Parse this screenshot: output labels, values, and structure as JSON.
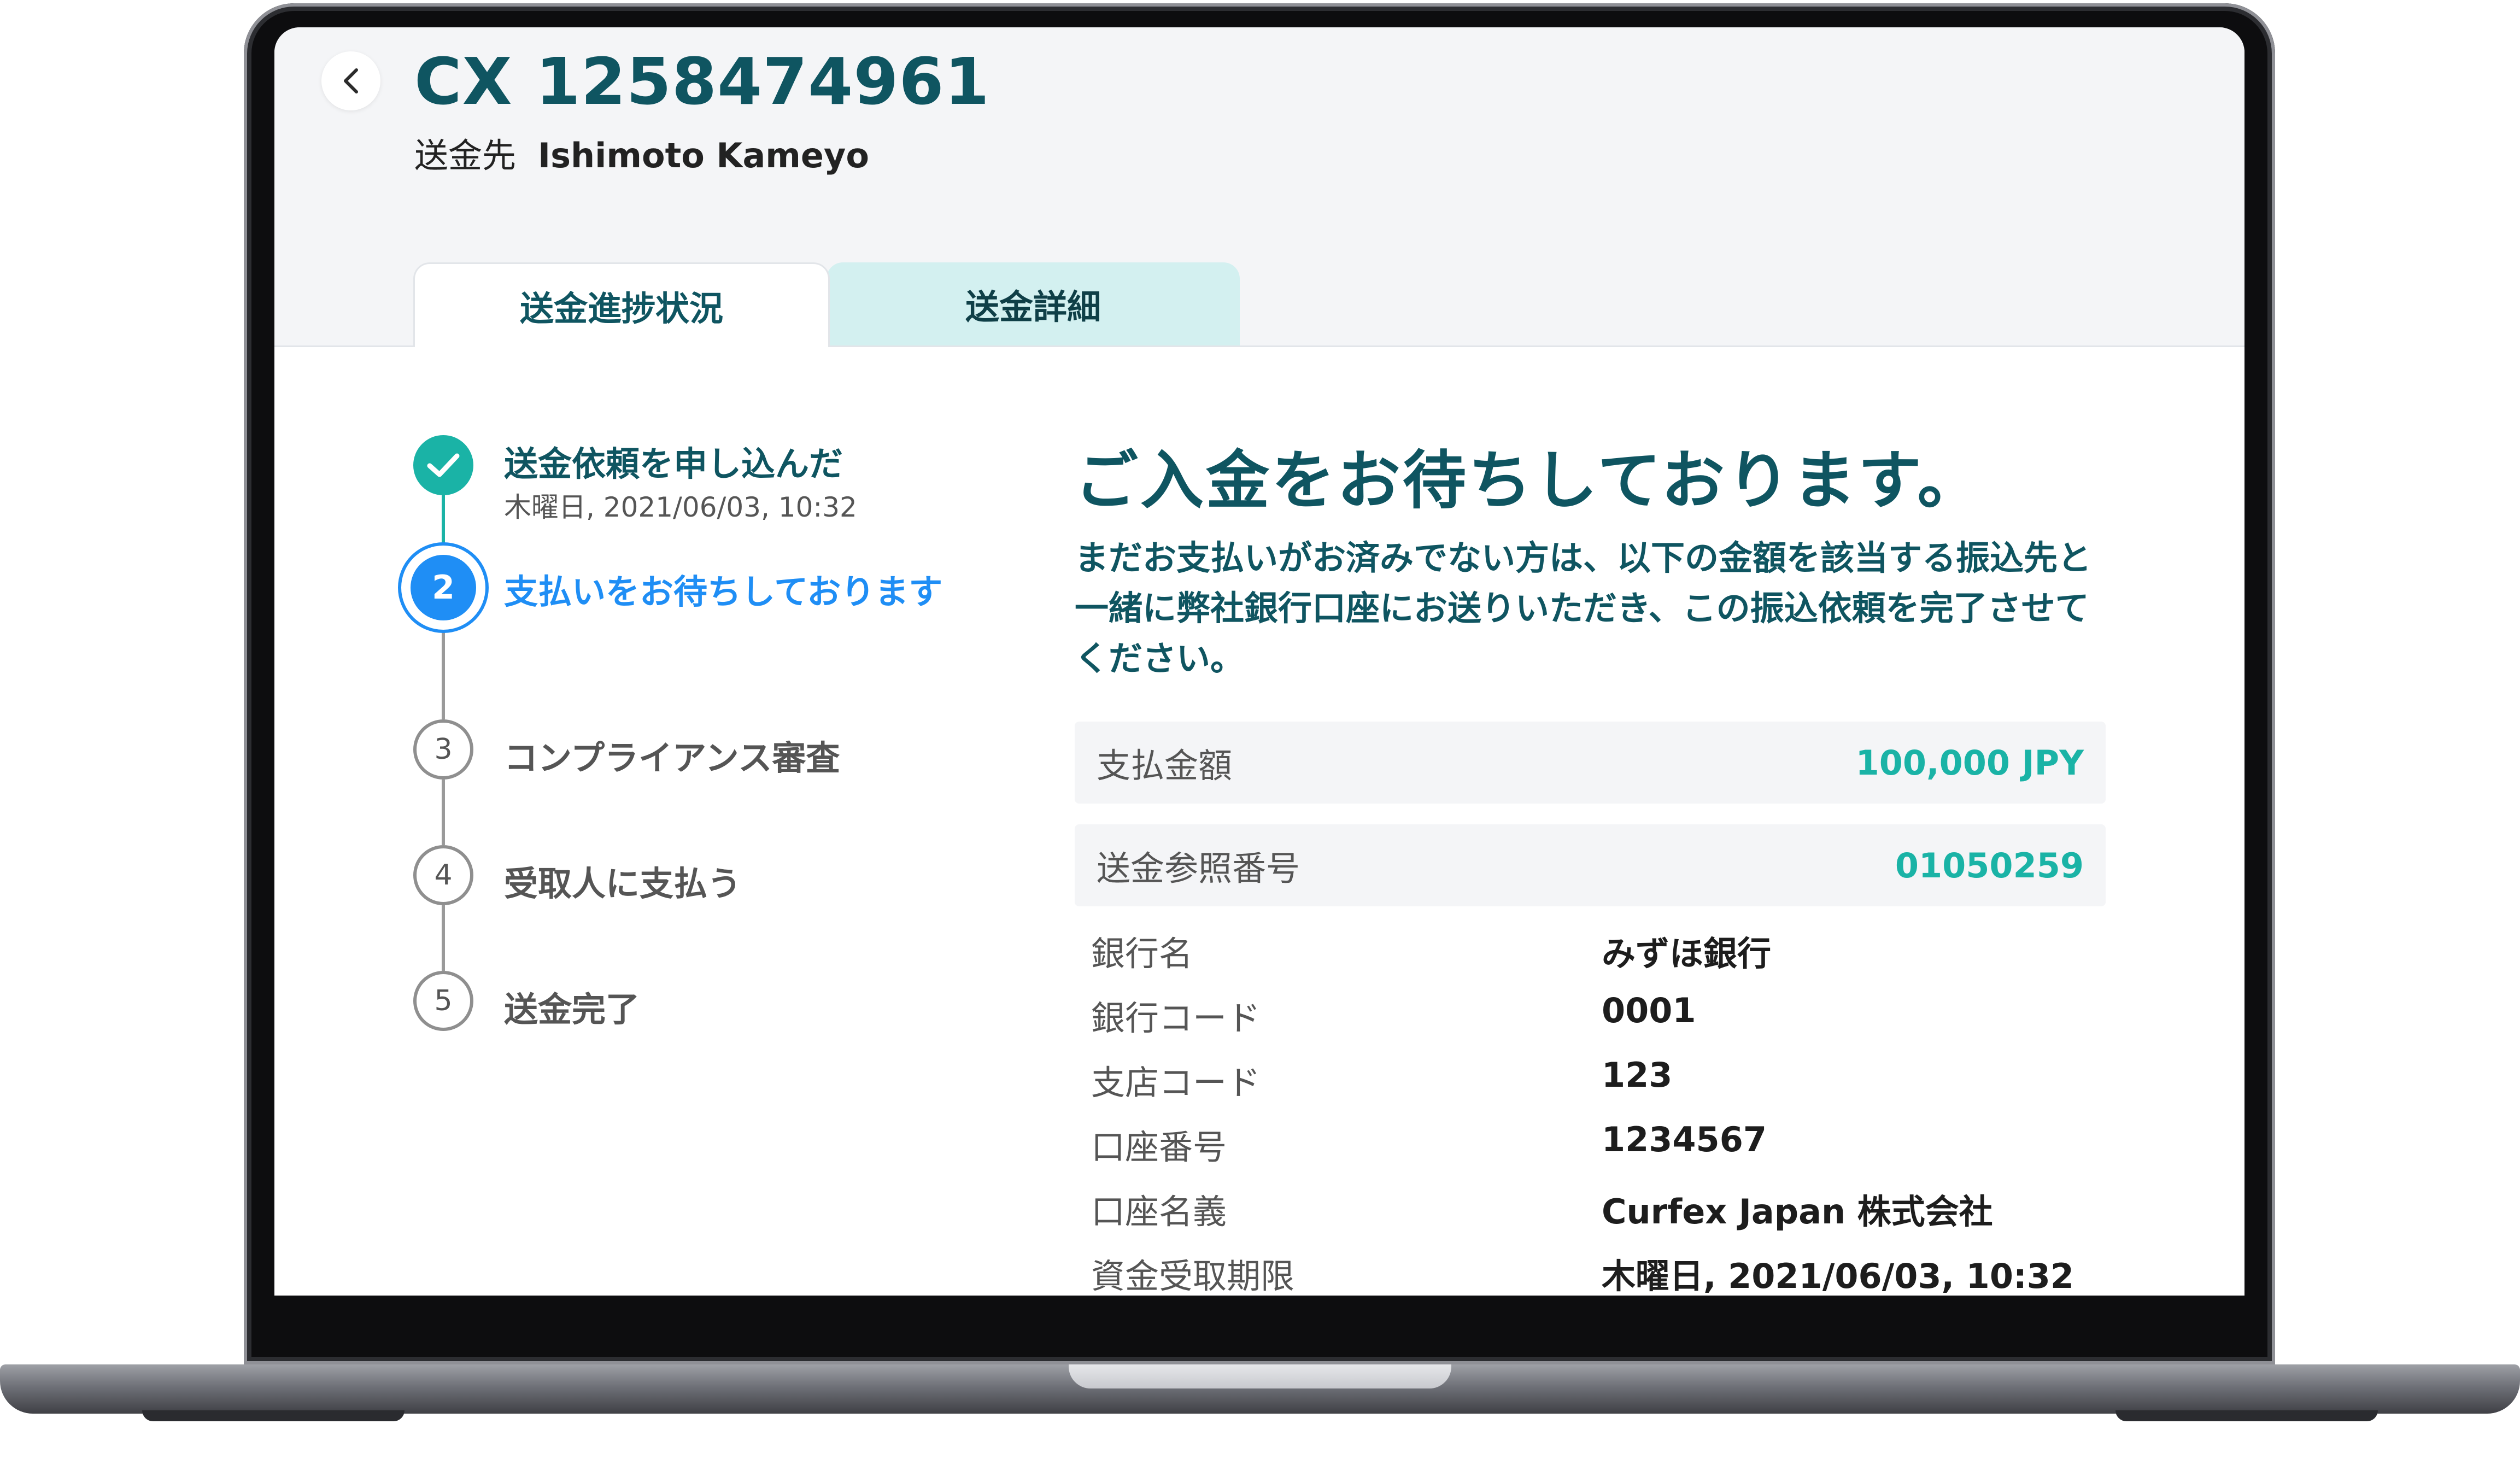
{
  "header": {
    "back_icon": "chevron-left-icon",
    "transaction_id": "CX 1258474961",
    "recipient_label": "送金先",
    "recipient_name": "Ishimoto Kameyo"
  },
  "tabs": [
    {
      "label": "送金進捗状況",
      "active": true
    },
    {
      "label": "送金詳細",
      "active": false
    }
  ],
  "steps": [
    {
      "number": "",
      "icon": "check-icon",
      "label": "送金依頼を申し込んだ",
      "date": "木曜日, 2021/06/03, 10:32",
      "status": "done"
    },
    {
      "number": "2",
      "label": "支払いをお待ちしております",
      "status": "current"
    },
    {
      "number": "3",
      "label": "コンプライアンス審査",
      "status": "pending"
    },
    {
      "number": "4",
      "label": "受取人に支払う",
      "status": "pending"
    },
    {
      "number": "5",
      "label": "送金完了",
      "status": "pending"
    }
  ],
  "main": {
    "heading": "ご入金をお待ちしております。",
    "instructions": "まだお支払いがお済みでない方は、以下の金額を該当する振込先と一緒に弊社銀行口座にお送りいただき、この振込依頼を完了させてください。",
    "summary": [
      {
        "label": "支払金額",
        "value": "100,000 JPY"
      },
      {
        "label": "送金参照番号",
        "value": "01050259"
      }
    ],
    "details": [
      {
        "label": "銀行名",
        "value": "みずほ銀行"
      },
      {
        "label": "銀行コード",
        "value": "0001"
      },
      {
        "label": "支店コード",
        "value": "123"
      },
      {
        "label": "口座番号",
        "value": "1234567"
      },
      {
        "label": "口座名義",
        "value": "Curfex Japan 株式会社"
      },
      {
        "label": "資金受取期限",
        "value": "木曜日, 2021/06/03, 10:32"
      }
    ]
  },
  "colors": {
    "primary_dark_teal": "#0f5561",
    "accent_teal": "#1ab3a6",
    "current_step_blue": "#1f8ef5",
    "inactive_tab_bg": "#d3f0f0"
  }
}
